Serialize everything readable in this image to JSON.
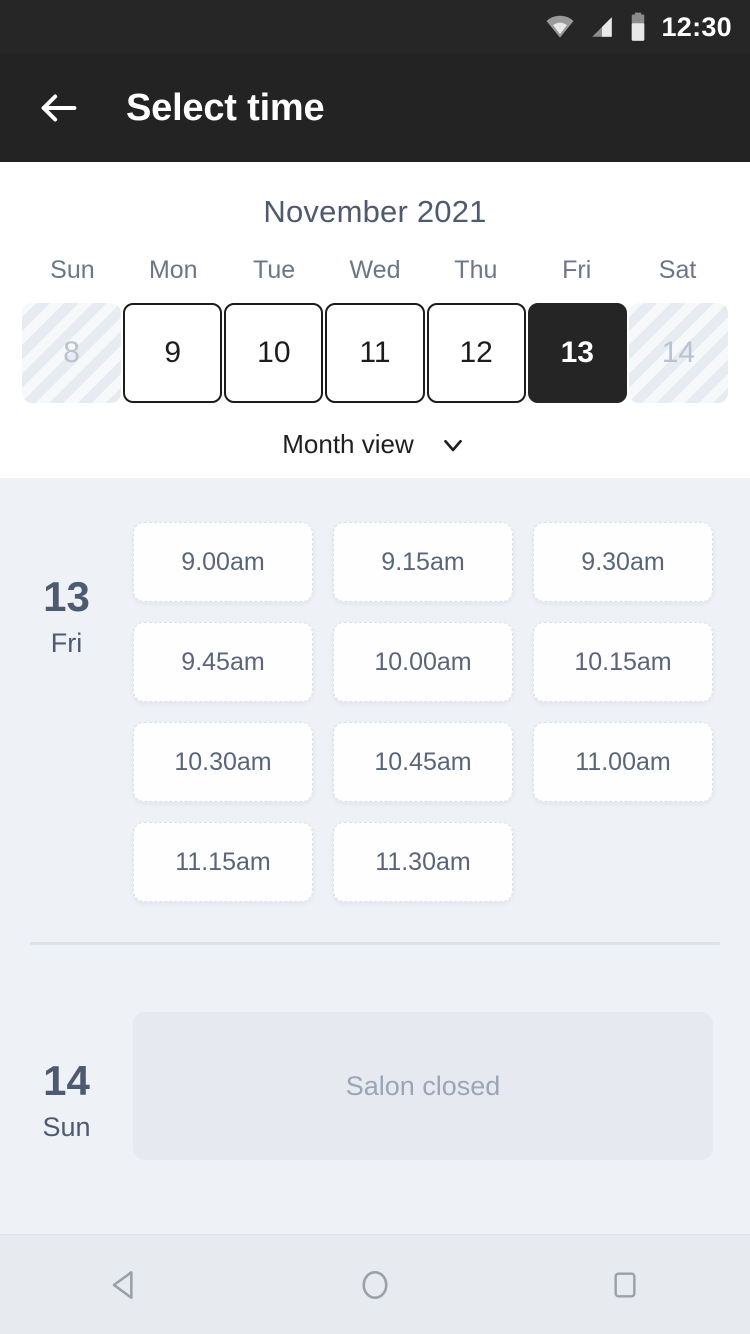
{
  "status_bar": {
    "time": "12:30",
    "icons": [
      "wifi-icon",
      "cellular-signal-icon",
      "battery-icon"
    ]
  },
  "app_bar": {
    "back_icon": "back-arrow-icon",
    "title": "Select time"
  },
  "calendar": {
    "month_label": "November 2021",
    "weekdays": [
      "Sun",
      "Mon",
      "Tue",
      "Wed",
      "Thu",
      "Fri",
      "Sat"
    ],
    "days": [
      {
        "label": "8",
        "state": "disabled"
      },
      {
        "label": "9",
        "state": "available"
      },
      {
        "label": "10",
        "state": "available"
      },
      {
        "label": "11",
        "state": "available"
      },
      {
        "label": "12",
        "state": "available"
      },
      {
        "label": "13",
        "state": "selected"
      },
      {
        "label": "14",
        "state": "disabled"
      }
    ],
    "view_toggle": {
      "label": "Month view",
      "icon": "chevron-down-icon"
    }
  },
  "schedule": [
    {
      "day_number": "13",
      "day_of_week": "Fri",
      "slots": [
        "9.00am",
        "9.15am",
        "9.30am",
        "9.45am",
        "10.00am",
        "10.15am",
        "10.30am",
        "10.45am",
        "11.00am",
        "11.15am",
        "11.30am"
      ],
      "closed_message": null
    },
    {
      "day_number": "14",
      "day_of_week": "Sun",
      "slots": [],
      "closed_message": "Salon closed"
    }
  ],
  "nav_bar": {
    "back": "nav-back-icon",
    "home": "nav-home-icon",
    "recents": "nav-recents-icon"
  },
  "colors": {
    "appbar_bg": "#232323",
    "statusbar_bg": "#262626",
    "body_bg": "#eef1f6",
    "text_slate": "#4e5a70",
    "selected_day_bg": "#252525",
    "slot_bg": "#fefeff",
    "closed_bg": "#e6eaf0"
  }
}
